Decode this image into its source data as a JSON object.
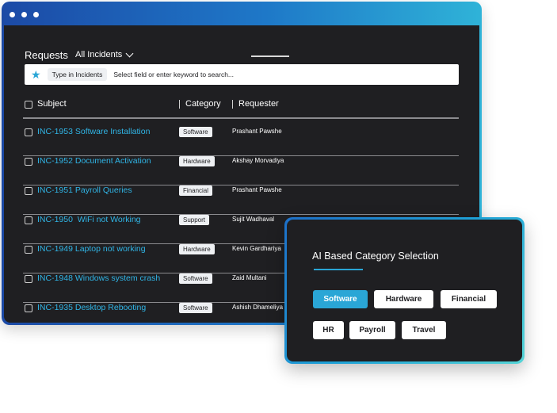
{
  "header": {
    "title": "Requests",
    "filter": "All Incidents"
  },
  "search": {
    "chip": "Type in Incidents",
    "placeholder": "Select field or enter keyword to search..."
  },
  "table": {
    "columns": [
      "Subject",
      "Category",
      "Requester"
    ],
    "rows": [
      {
        "subject": "INC-1953 Software Installation",
        "category": "Software",
        "requester": "Prashant Pawshe"
      },
      {
        "subject": "INC-1952 Document Activation",
        "category": "Hardware",
        "requester": "Akshay Morvadiya"
      },
      {
        "subject": "INC-1951 Payroll Queries",
        "category": "Financial",
        "requester": "Prashant Pawshe"
      },
      {
        "subject": "INC-1950  WiFi not Working",
        "category": "Support",
        "requester": "Sujit Wadhaval"
      },
      {
        "subject": "INC-1949 Laptop not working",
        "category": "Hardware",
        "requester": "Kevin Gardhariya"
      },
      {
        "subject": "INC-1948 Windows system crash",
        "category": "Software",
        "requester": "Zaid Multani"
      },
      {
        "subject": "INC-1935 Desktop Rebooting",
        "category": "Software",
        "requester": "Ashish Dhameliya"
      }
    ]
  },
  "ai_panel": {
    "title": "AI Based Category Selection",
    "categories": [
      "Software",
      "Hardware",
      "Financial",
      "HR",
      "Payroll",
      "Travel"
    ],
    "selected": "Software"
  },
  "colors": {
    "accent": "#2aa6d6",
    "panel_bg": "#1f1f22",
    "link": "#30b5e6"
  },
  "icons": {
    "search_field": "star-icon",
    "dropdown": "chevron-down-icon"
  }
}
